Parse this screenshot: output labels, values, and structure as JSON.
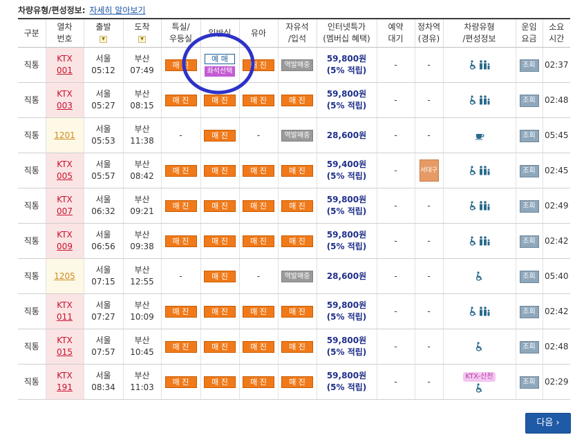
{
  "top": {
    "title": "차량유형/편성정보:",
    "link": "자세히 알아보기"
  },
  "columns": [
    {
      "l1": "구분",
      "l2": ""
    },
    {
      "l1": "열차",
      "l2": "번호"
    },
    {
      "l1": "출발",
      "l2": ""
    },
    {
      "l1": "도착",
      "l2": ""
    },
    {
      "l1": "특실/",
      "l2": "우등실"
    },
    {
      "l1": "일반실",
      "l2": ""
    },
    {
      "l1": "유아",
      "l2": ""
    },
    {
      "l1": "자유석",
      "l2": "/입석"
    },
    {
      "l1": "인터넷특가",
      "l2": "(멤버십 혜택)"
    },
    {
      "l1": "예약",
      "l2": "대기"
    },
    {
      "l1": "정차역",
      "l2": "(경유)"
    },
    {
      "l1": "차량유형",
      "l2": "/편성정보"
    },
    {
      "l1": "운임",
      "l2": "요금"
    },
    {
      "l1": "소요",
      "l2": "시간"
    }
  ],
  "labels": {
    "sold": "매 진",
    "book": "예 매",
    "seat_select": "좌석선택",
    "station_sale": "역발매중",
    "fare_btn": "조회",
    "seodaegu": "서대구",
    "ktx_sancheon": "KTX-산천",
    "dash": "-",
    "next": "다음"
  },
  "rows": [
    {
      "kind": "직통",
      "type": "ktx",
      "l1": "KTX",
      "num": "001",
      "dep_st": "서울",
      "dep": "05:12",
      "arr_st": "부산",
      "arr": "07:49",
      "special": "sold",
      "general": "book",
      "infant": "sold",
      "free": "station",
      "price": "59,800원",
      "points": "(5% 적립)",
      "wait": "-",
      "stop": "-",
      "icons": "ktx-family",
      "fare": "조회",
      "dur": "02:37"
    },
    {
      "kind": "직통",
      "type": "ktx",
      "l1": "KTX",
      "num": "003",
      "dep_st": "서울",
      "dep": "05:27",
      "arr_st": "부산",
      "arr": "08:15",
      "special": "sold",
      "general": "sold",
      "infant": "sold",
      "free": "sold",
      "price": "59,800원",
      "points": "(5% 적립)",
      "wait": "-",
      "stop": "-",
      "icons": "ktx-family",
      "fare": "조회",
      "dur": "02:48"
    },
    {
      "kind": "직통",
      "type": "mugung",
      "l1": "",
      "num": "1201",
      "dep_st": "서울",
      "dep": "05:53",
      "arr_st": "부산",
      "arr": "11:38",
      "special": "dash",
      "general": "sold",
      "infant": "dash",
      "free": "station",
      "price": "28,600원",
      "points": "",
      "wait": "-",
      "stop": "-",
      "icons": "cafe",
      "fare": "조회",
      "dur": "05:45"
    },
    {
      "kind": "직통",
      "type": "ktx",
      "l1": "KTX",
      "num": "005",
      "dep_st": "서울",
      "dep": "05:57",
      "arr_st": "부산",
      "arr": "08:42",
      "special": "sold",
      "general": "sold",
      "infant": "sold",
      "free": "sold",
      "price": "59,400원",
      "points": "(5% 적립)",
      "wait": "-",
      "stop": "seodaegu",
      "icons": "ktx-family",
      "fare": "조회",
      "dur": "02:45"
    },
    {
      "kind": "직통",
      "type": "ktx",
      "l1": "KTX",
      "num": "007",
      "dep_st": "서울",
      "dep": "06:32",
      "arr_st": "부산",
      "arr": "09:21",
      "special": "sold",
      "general": "sold",
      "infant": "sold",
      "free": "sold",
      "price": "59,800원",
      "points": "(5% 적립)",
      "wait": "-",
      "stop": "-",
      "icons": "ktx-family",
      "fare": "조회",
      "dur": "02:49"
    },
    {
      "kind": "직통",
      "type": "ktx",
      "l1": "KTX",
      "num": "009",
      "dep_st": "서울",
      "dep": "06:56",
      "arr_st": "부산",
      "arr": "09:38",
      "special": "sold",
      "general": "sold",
      "infant": "sold",
      "free": "sold",
      "price": "59,800원",
      "points": "(5% 적립)",
      "wait": "-",
      "stop": "-",
      "icons": "ktx-family",
      "fare": "조회",
      "dur": "02:42"
    },
    {
      "kind": "직통",
      "type": "mugung",
      "l1": "",
      "num": "1205",
      "dep_st": "서울",
      "dep": "07:15",
      "arr_st": "부산",
      "arr": "12:55",
      "special": "dash",
      "general": "sold",
      "infant": "dash",
      "free": "station",
      "price": "28,600원",
      "points": "",
      "wait": "-",
      "stop": "-",
      "icons": "wheelchair",
      "fare": "조회",
      "dur": "05:40"
    },
    {
      "kind": "직통",
      "type": "ktx",
      "l1": "KTX",
      "num": "011",
      "dep_st": "서울",
      "dep": "07:27",
      "arr_st": "부산",
      "arr": "10:09",
      "special": "sold",
      "general": "sold",
      "infant": "sold",
      "free": "sold",
      "price": "59,800원",
      "points": "(5% 적립)",
      "wait": "-",
      "stop": "-",
      "icons": "ktx-family",
      "fare": "조회",
      "dur": "02:42"
    },
    {
      "kind": "직통",
      "type": "ktx",
      "l1": "KTX",
      "num": "015",
      "dep_st": "서울",
      "dep": "07:57",
      "arr_st": "부산",
      "arr": "10:45",
      "special": "sold",
      "general": "sold",
      "infant": "sold",
      "free": "sold",
      "price": "59,800원",
      "points": "(5% 적립)",
      "wait": "-",
      "stop": "-",
      "icons": "wheelchair",
      "fare": "조회",
      "dur": "02:48"
    },
    {
      "kind": "직통",
      "type": "ktx",
      "l1": "KTX",
      "num": "191",
      "dep_st": "서울",
      "dep": "08:34",
      "arr_st": "부산",
      "arr": "11:03",
      "special": "sold",
      "general": "sold",
      "infant": "sold",
      "free": "sold",
      "price": "59,800원",
      "points": "(5% 적립)",
      "wait": "-",
      "stop": "-",
      "icons": "sancheon",
      "fare": "조회",
      "dur": "02:29"
    }
  ],
  "colors": {
    "accent_orange": "#f07a1a",
    "price_blue": "#1f2f8a",
    "ktx_red": "#c8102e",
    "annotation_circle": "#2d32c8",
    "next_button": "#1f5aa6"
  }
}
